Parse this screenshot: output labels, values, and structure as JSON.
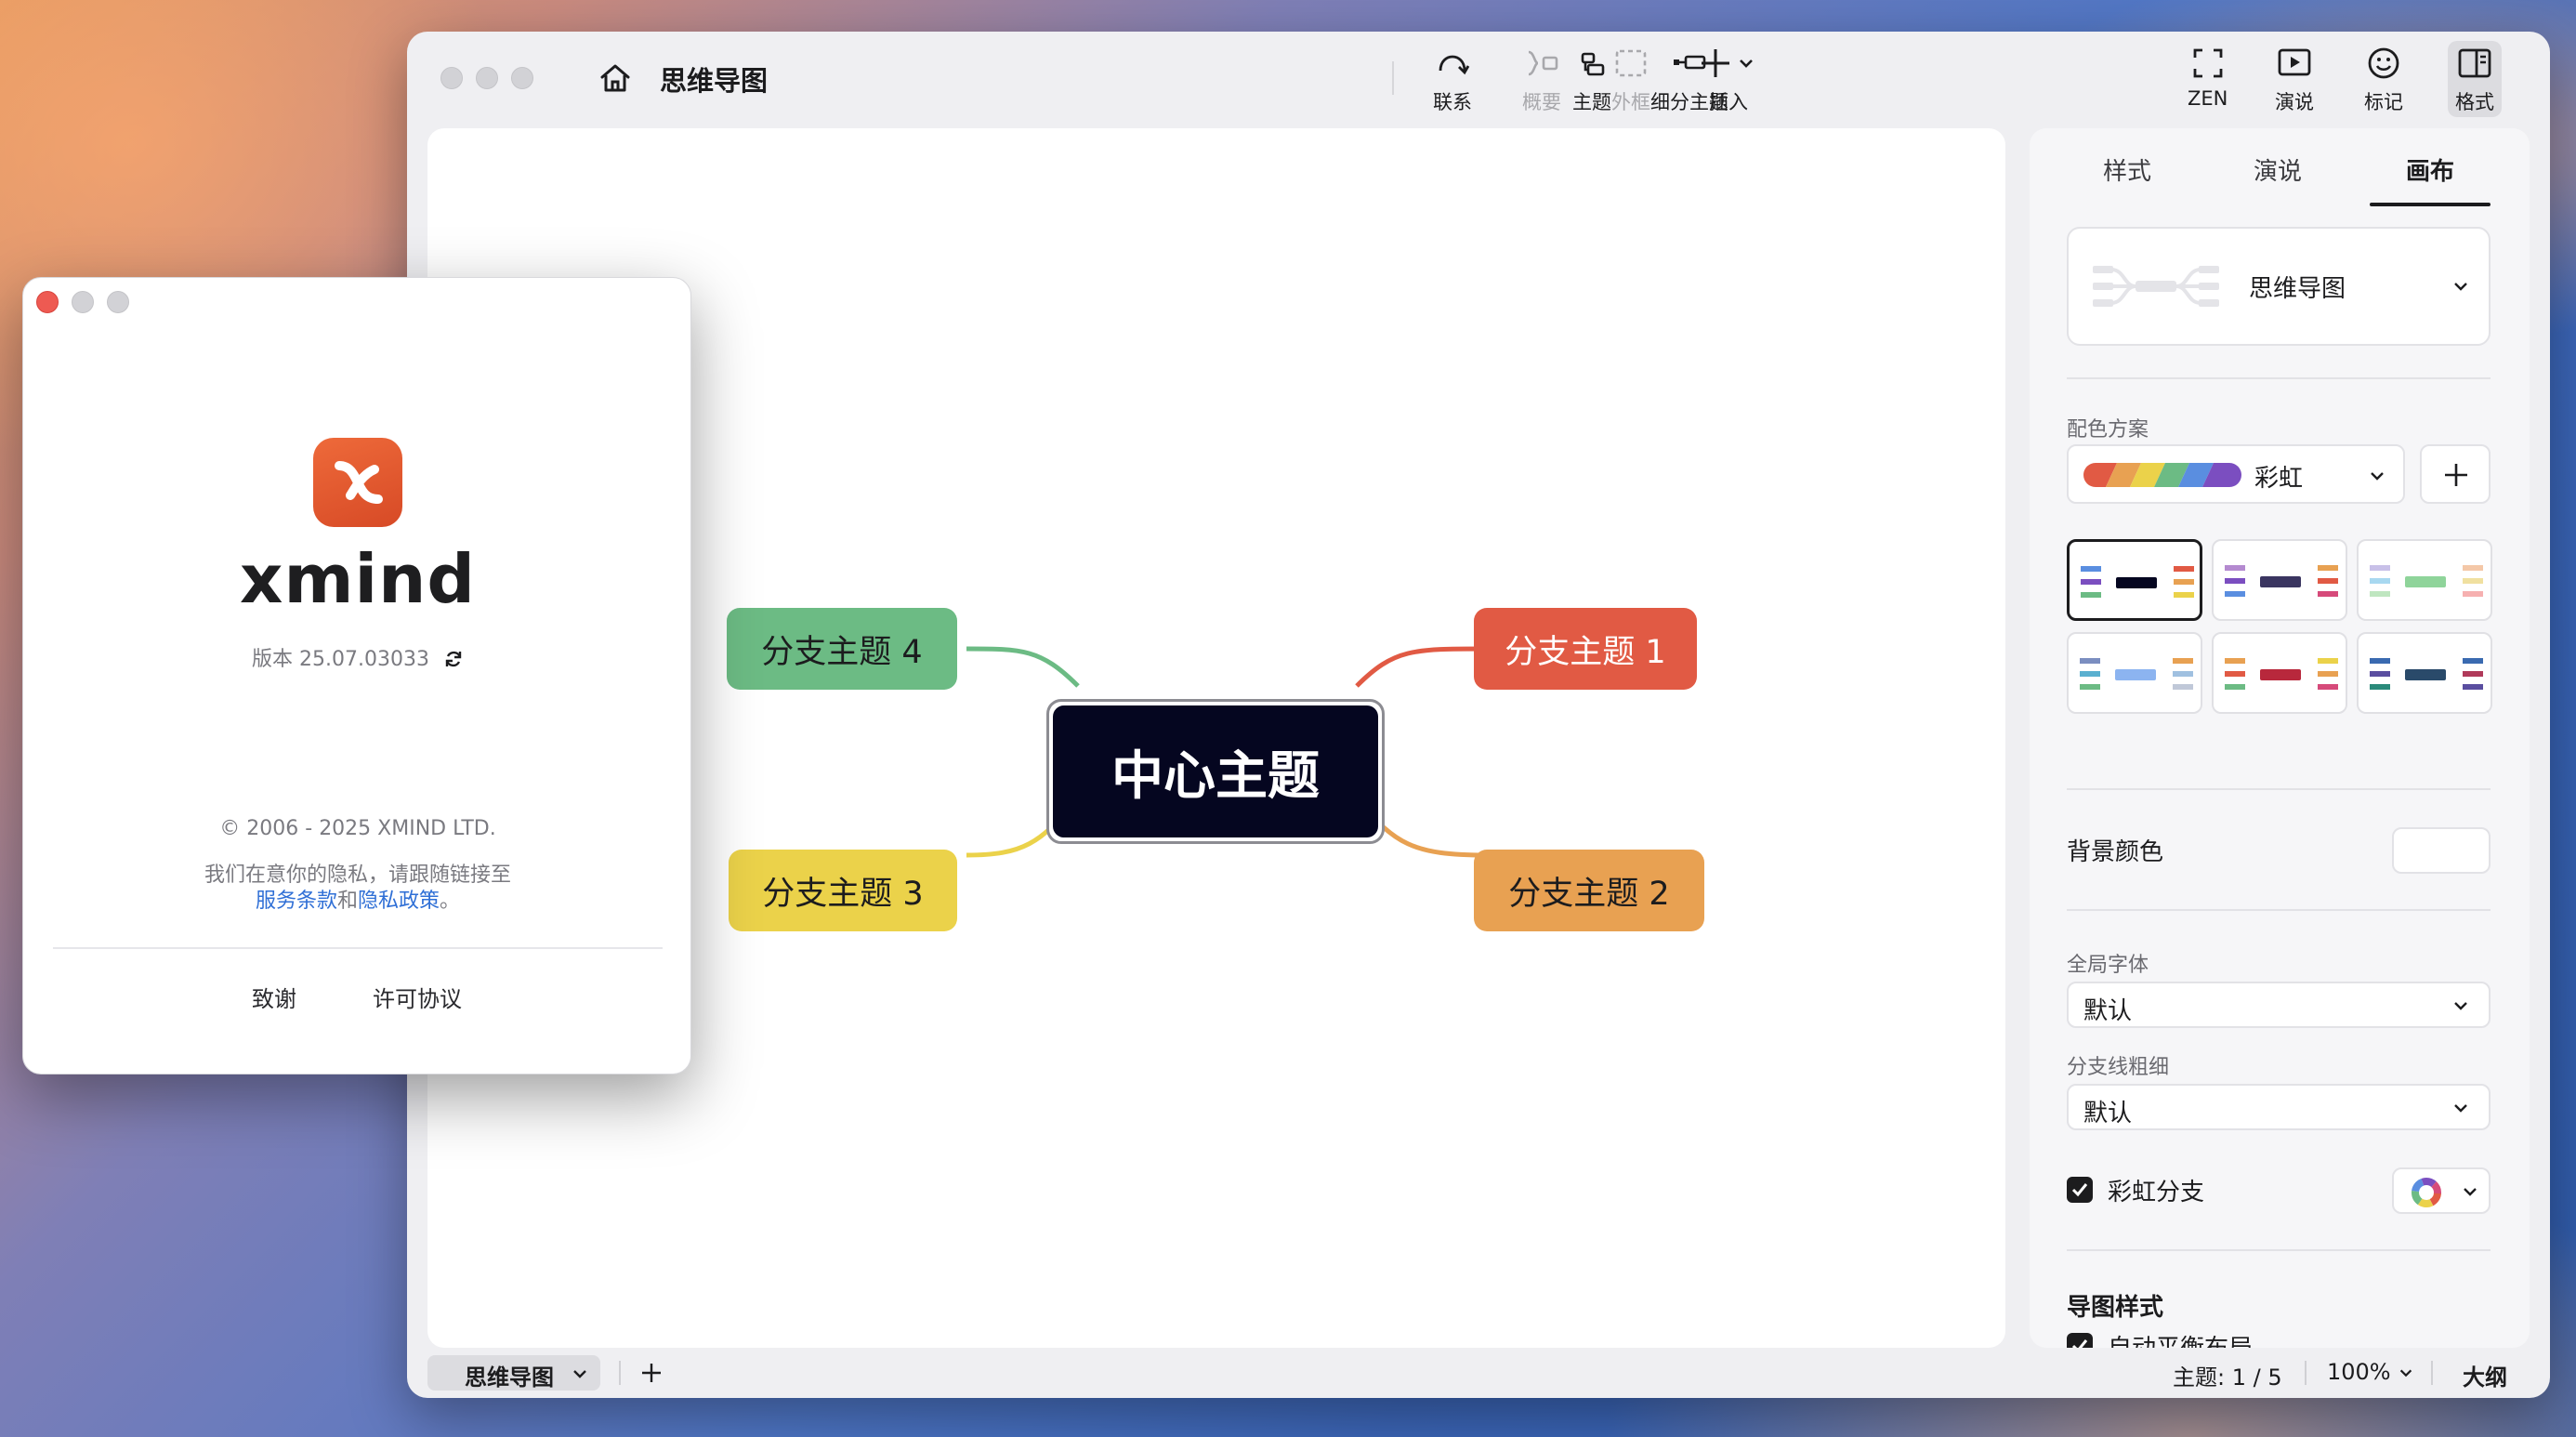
{
  "window": {
    "title": "思维导图"
  },
  "toolbar": {
    "topic": "主题",
    "subtopic": "细分主题",
    "relationship": "联系",
    "summary": "概要",
    "boundary": "外框",
    "insert": "插入",
    "zen": "ZEN",
    "pitch": "演说",
    "marker": "标记",
    "format": "格式"
  },
  "map": {
    "central": "中心主题",
    "branches": [
      "分支主题 1",
      "分支主题 2",
      "分支主题 3",
      "分支主题 4"
    ],
    "colors": {
      "central_bg": "#050620",
      "branch1": "#e15a44",
      "branch2": "#e8a152",
      "branch3": "#ebd24a",
      "branch4": "#6cbb84"
    }
  },
  "panel": {
    "tabs": [
      "样式",
      "演说",
      "画布"
    ],
    "active_tab": "画布",
    "structure": "思维导图",
    "color_scheme_label": "配色方案",
    "color_scheme_value": "彩虹",
    "bg_color_label": "背景颜色",
    "global_font_label": "全局字体",
    "global_font_value": "默认",
    "branch_width_label": "分支线粗细",
    "branch_width_value": "默认",
    "rainbow_branch_label": "彩虹分支",
    "rainbow_branch_checked": true,
    "map_style_label": "导图样式",
    "auto_balance_label": "自动平衡布局",
    "auto_balance_checked": true
  },
  "statusbar": {
    "sheet": "思维导图",
    "topic_count": "主题: 1 / 5",
    "zoom": "100%",
    "outline": "大纲"
  },
  "about": {
    "brand": "xmind",
    "version": "版本 25.07.03033",
    "copyright": "© 2006 - 2025 XMIND LTD.",
    "privacy_prefix": "我们在意你的隐私，请跟随链接至",
    "terms_link": "服务条款",
    "and": "和",
    "privacy_link": "隐私政策",
    "period": "。",
    "credits": "致谢",
    "license": "许可协议"
  }
}
